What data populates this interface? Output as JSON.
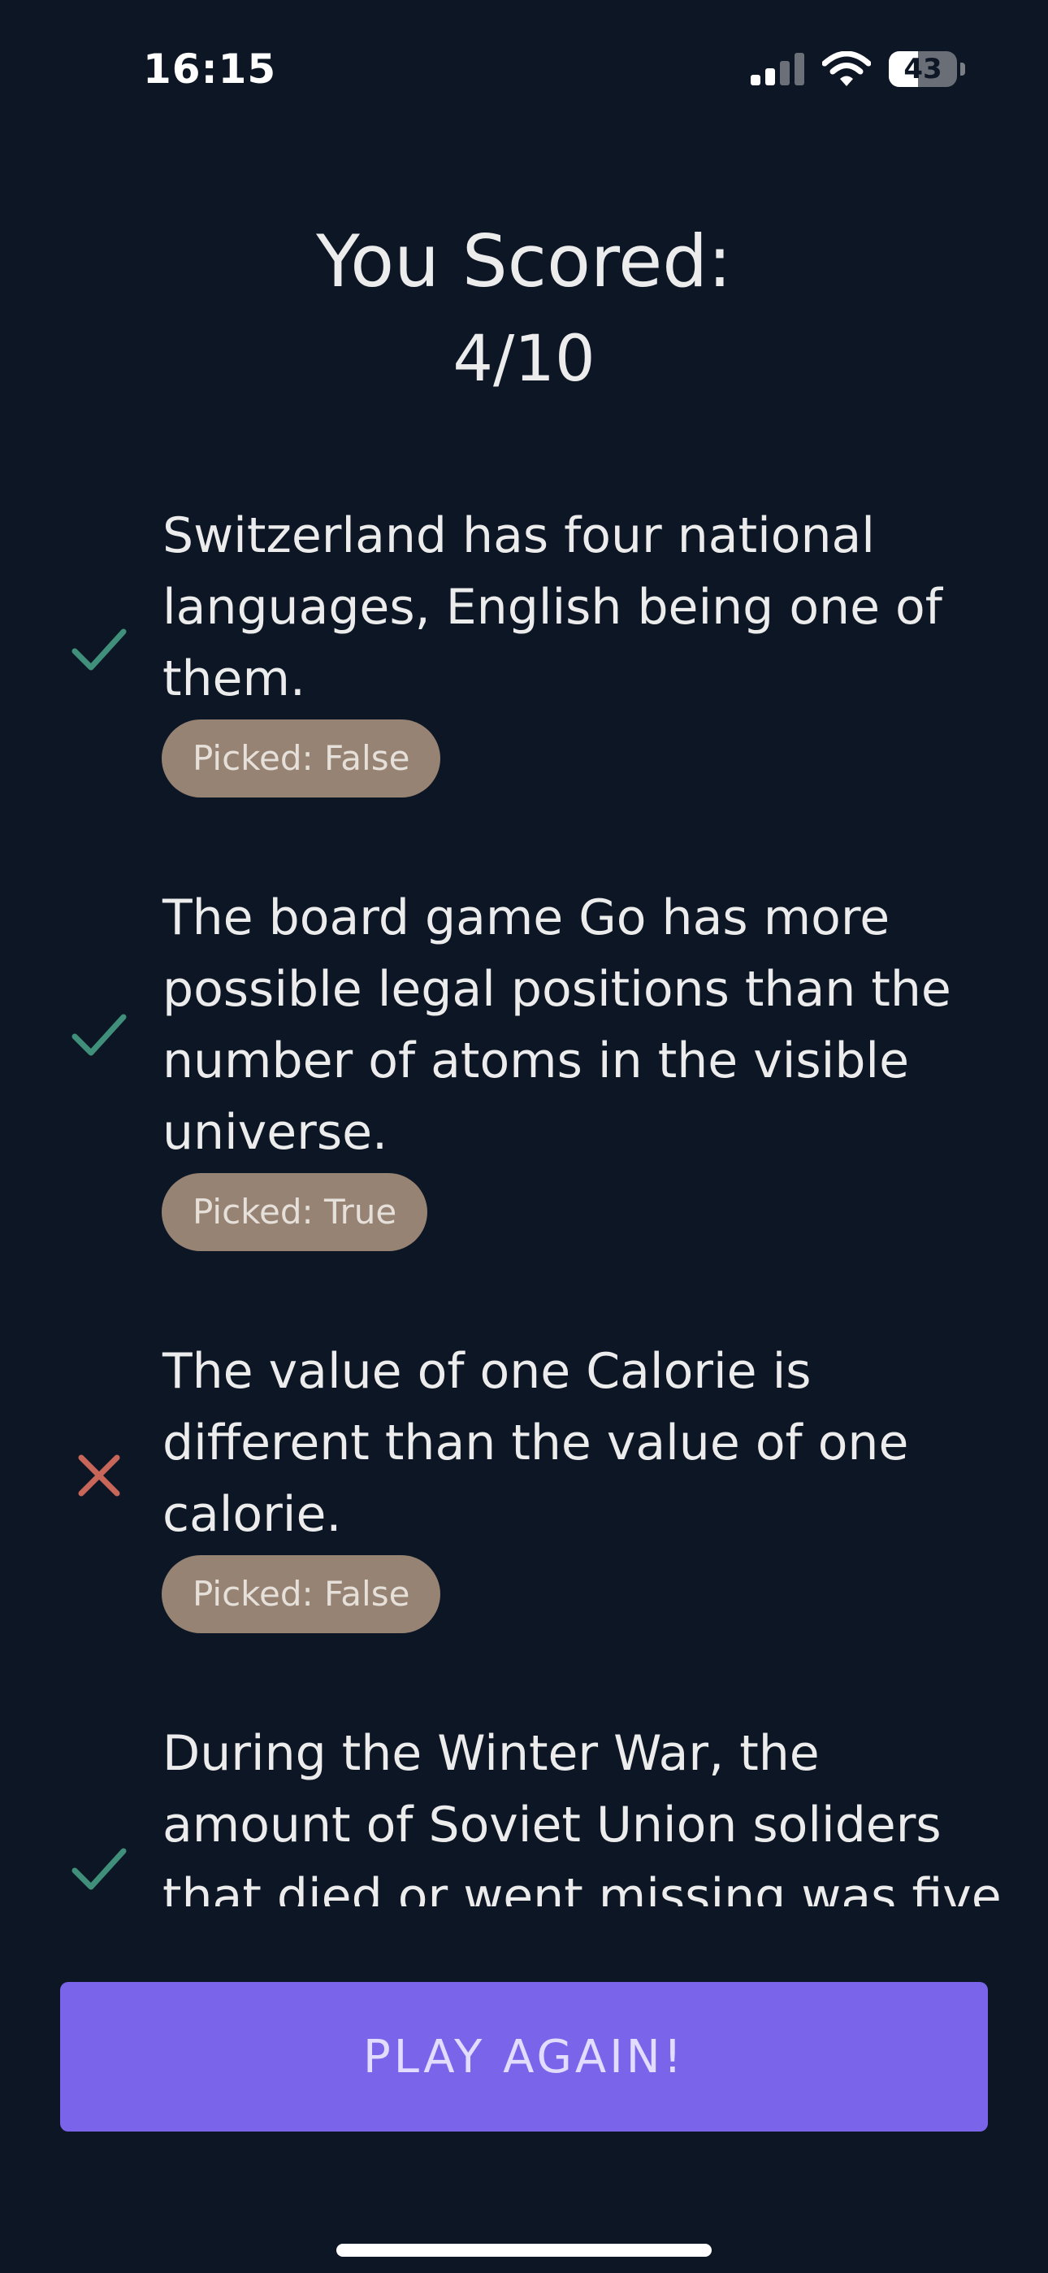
{
  "status_bar": {
    "time": "16:15",
    "battery": 43
  },
  "header": {
    "title": "You Scored:",
    "score": "4/10"
  },
  "results": [
    {
      "question": "Switzerland has four national languages, English being one of them.",
      "picked": "Picked: False",
      "correct": true
    },
    {
      "question": "The board game Go has more possible legal positions than the number of atoms in the visible universe.",
      "picked": "Picked: True",
      "correct": true
    },
    {
      "question": "The value of one Calorie is different than the value of one calorie.",
      "picked": "Picked: False",
      "correct": false
    },
    {
      "question": "During the Winter War, the amount of Soviet Union soliders that died or went missing was five times more than Finland's.",
      "picked": "",
      "correct": true
    }
  ],
  "colors": {
    "correct_icon": "#3f8f7a",
    "wrong_icon": "#c8665a",
    "badge_bg": "#978373",
    "button_bg": "#7a64ea"
  },
  "icons": {
    "correct": "checkmark-icon",
    "wrong": "cross-icon"
  },
  "actions": {
    "play_again_label": "PLAY AGAIN!"
  }
}
